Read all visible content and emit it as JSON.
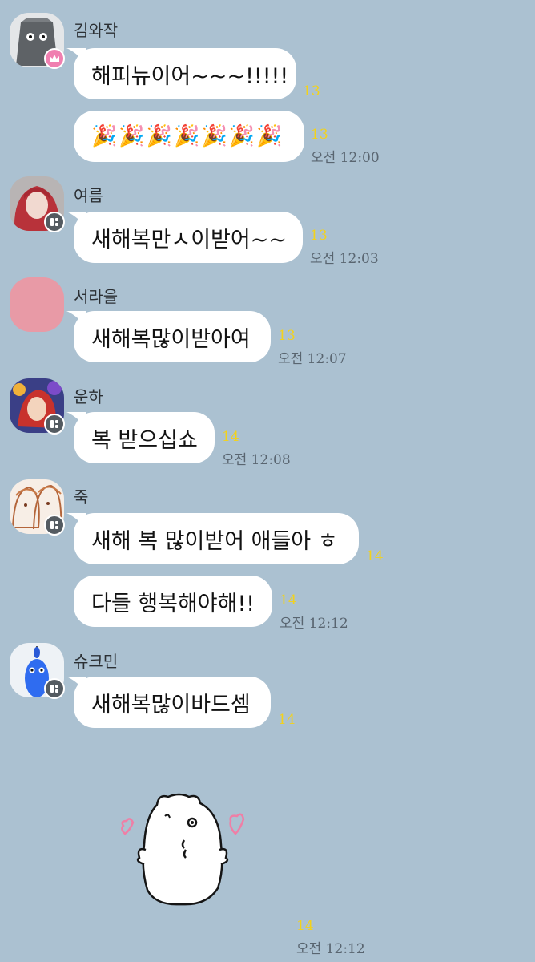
{
  "chat": {
    "messages": [
      {
        "sender": "김와작",
        "bubbles": [
          {
            "text": "해피뉴이어~~~!!!!!",
            "unread": "13"
          },
          {
            "text": "🎉🎉🎉🎉🎉🎉🎉",
            "unread": "13",
            "time": "오전 12:00"
          }
        ]
      },
      {
        "sender": "여름",
        "bubbles": [
          {
            "text": "새해복만ㅅ이받어~~",
            "unread": "13",
            "time": "오전 12:03"
          }
        ]
      },
      {
        "sender": "서라을",
        "bubbles": [
          {
            "text": "새해복많이받아여",
            "unread": "13",
            "time": "오전 12:07"
          }
        ]
      },
      {
        "sender": "운하",
        "bubbles": [
          {
            "text": "복 받으십쇼",
            "unread": "14",
            "time": "오전 12:08"
          }
        ]
      },
      {
        "sender": "죽",
        "bubbles": [
          {
            "text": "새해 복 많이받어 애들아 ㅎ",
            "unread": "14"
          },
          {
            "text": "다들 행복해야해!!",
            "unread": "14",
            "time": "오전 12:12"
          }
        ]
      },
      {
        "sender": "슈크민",
        "bubbles": [
          {
            "text": "새해복많이바드셈",
            "unread": "14"
          }
        ]
      }
    ],
    "sticker": {
      "unread": "14",
      "time": "오전 12:12"
    }
  },
  "colors": {
    "background": "#abc1d1",
    "unread": "#f3d21b",
    "bubble": "#ffffff"
  }
}
